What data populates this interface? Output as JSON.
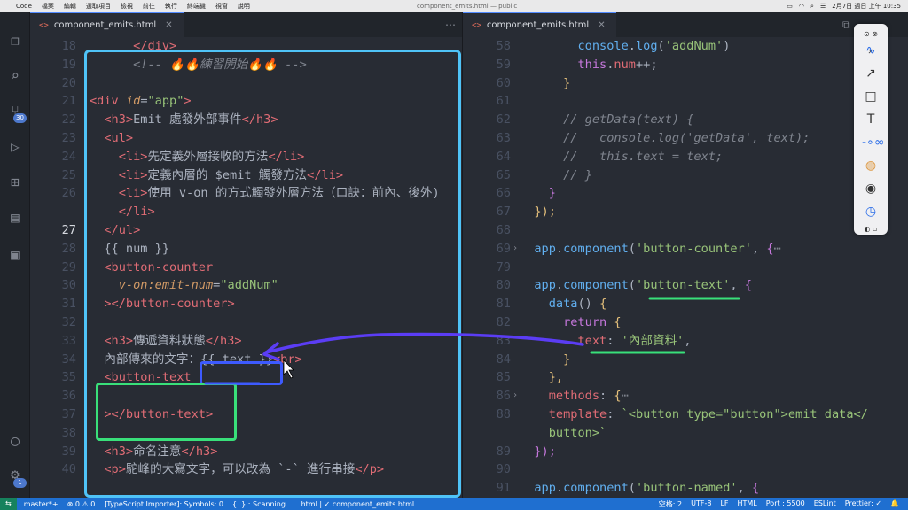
{
  "menubar": {
    "app": "Code",
    "items": [
      "檔案",
      "編輯",
      "選取項目",
      "檢視",
      "前往",
      "執行",
      "終端機",
      "視窗",
      "說明"
    ],
    "window_title": "component_emits.html — public",
    "clock": "2月7日 週日 上午 10:35"
  },
  "activity": {
    "scm_badge": "30",
    "settings_badge": "1"
  },
  "left_editor": {
    "tab_label": "component_emits.html",
    "lines": [
      {
        "n": "18",
        "fold": "",
        "t": [
          [
            "tok-plain",
            "      "
          ],
          [
            "tok-tag",
            "</div>"
          ]
        ]
      },
      {
        "n": "19",
        "fold": "",
        "t": [
          [
            "tok-plain",
            "      "
          ],
          [
            "tok-cmt",
            "<!-- 🔥🔥練習開始🔥🔥 -->"
          ]
        ]
      },
      {
        "n": "20",
        "fold": "",
        "t": []
      },
      {
        "n": "21",
        "fold": "",
        "t": [
          [
            "tok-tag",
            "<div"
          ],
          [
            "tok-plain",
            " "
          ],
          [
            "tok-attr",
            "id"
          ],
          [
            "tok-plain",
            "="
          ],
          [
            "tok-str",
            "\"app\""
          ],
          [
            "tok-tag",
            ">"
          ]
        ]
      },
      {
        "n": "22",
        "fold": "",
        "t": [
          [
            "tok-plain",
            "  "
          ],
          [
            "tok-tag",
            "<h3>"
          ],
          [
            "tok-plain",
            "Emit 處發外部事件"
          ],
          [
            "tok-tag",
            "</h3>"
          ]
        ]
      },
      {
        "n": "23",
        "fold": "",
        "t": [
          [
            "tok-plain",
            "  "
          ],
          [
            "tok-tag",
            "<ul>"
          ]
        ]
      },
      {
        "n": "24",
        "fold": "",
        "t": [
          [
            "tok-plain",
            "    "
          ],
          [
            "tok-tag",
            "<li>"
          ],
          [
            "tok-plain",
            "先定義外層接收的方法"
          ],
          [
            "tok-tag",
            "</li>"
          ]
        ]
      },
      {
        "n": "25",
        "fold": "",
        "t": [
          [
            "tok-plain",
            "    "
          ],
          [
            "tok-tag",
            "<li>"
          ],
          [
            "tok-plain",
            "定義內層的 $emit 觸發方法"
          ],
          [
            "tok-tag",
            "</li>"
          ]
        ]
      },
      {
        "n": "26",
        "fold": "",
        "t": [
          [
            "tok-plain",
            "    "
          ],
          [
            "tok-tag",
            "<li>"
          ],
          [
            "tok-plain",
            "使用 v-on 的方式觸發外層方法（口訣：前內、後外)"
          ]
        ]
      },
      {
        "n": "",
        "fold": "",
        "t": [
          [
            "tok-plain",
            "    "
          ],
          [
            "tok-tag",
            "</li>"
          ]
        ]
      },
      {
        "n": "27",
        "fold": "",
        "active": true,
        "t": [
          [
            "tok-plain",
            "  "
          ],
          [
            "tok-tag",
            "</ul>"
          ]
        ]
      },
      {
        "n": "28",
        "fold": "",
        "t": [
          [
            "tok-plain",
            "  {{ num }}"
          ]
        ]
      },
      {
        "n": "29",
        "fold": "",
        "t": [
          [
            "tok-plain",
            "  "
          ],
          [
            "tok-tag",
            "<button-counter"
          ]
        ]
      },
      {
        "n": "30",
        "fold": "",
        "t": [
          [
            "tok-plain",
            "    "
          ],
          [
            "tok-attr",
            "v-on:emit-num"
          ],
          [
            "tok-plain",
            "="
          ],
          [
            "tok-str",
            "\"addNum\""
          ]
        ]
      },
      {
        "n": "31",
        "fold": "",
        "t": [
          [
            "tok-plain",
            "  "
          ],
          [
            "tok-tag",
            "></button-counter>"
          ]
        ]
      },
      {
        "n": "32",
        "fold": "",
        "t": []
      },
      {
        "n": "33",
        "fold": "",
        "t": [
          [
            "tok-plain",
            "  "
          ],
          [
            "tok-tag",
            "<h3>"
          ],
          [
            "tok-plain",
            "傳遞資料狀態"
          ],
          [
            "tok-tag",
            "</h3>"
          ]
        ]
      },
      {
        "n": "34",
        "fold": "",
        "t": [
          [
            "tok-plain",
            "  內部傳來的文字：{{ text }}"
          ],
          [
            "tok-tag",
            "<br>"
          ]
        ]
      },
      {
        "n": "35",
        "fold": "",
        "t": [
          [
            "tok-plain",
            "  "
          ],
          [
            "tok-tag",
            "<button-text"
          ]
        ]
      },
      {
        "n": "36",
        "fold": "",
        "t": []
      },
      {
        "n": "37",
        "fold": "",
        "t": [
          [
            "tok-plain",
            "  "
          ],
          [
            "tok-tag",
            "></button-text>"
          ]
        ]
      },
      {
        "n": "38",
        "fold": "",
        "t": []
      },
      {
        "n": "39",
        "fold": "",
        "t": [
          [
            "tok-plain",
            "  "
          ],
          [
            "tok-tag",
            "<h3>"
          ],
          [
            "tok-plain",
            "命名注意"
          ],
          [
            "tok-tag",
            "</h3>"
          ]
        ]
      },
      {
        "n": "40",
        "fold": "",
        "t": [
          [
            "tok-plain",
            "  "
          ],
          [
            "tok-tag",
            "<p>"
          ],
          [
            "tok-plain",
            "駝峰的大寫文字，可以改為 `-` 進行串接"
          ],
          [
            "tok-tag",
            "</p>"
          ]
        ]
      }
    ]
  },
  "right_editor": {
    "tab_label": "component_emits.html",
    "lines": [
      {
        "n": "58",
        "fold": "",
        "t": [
          [
            "tok-plain",
            "        "
          ],
          [
            "tok-fn",
            "console"
          ],
          [
            "tok-punc",
            "."
          ],
          [
            "tok-fn",
            "log"
          ],
          [
            "tok-punc",
            "("
          ],
          [
            "tok-str",
            "'addNum'"
          ],
          [
            "tok-punc",
            ")"
          ]
        ]
      },
      {
        "n": "59",
        "fold": "",
        "t": [
          [
            "tok-plain",
            "        "
          ],
          [
            "tok-kw",
            "this"
          ],
          [
            "tok-punc",
            "."
          ],
          [
            "tok-prop",
            "num"
          ],
          [
            "tok-punc",
            "++;"
          ]
        ]
      },
      {
        "n": "60",
        "fold": "",
        "t": [
          [
            "tok-plain",
            "      "
          ],
          [
            "tok-brk",
            "}"
          ]
        ]
      },
      {
        "n": "61",
        "fold": "",
        "t": []
      },
      {
        "n": "62",
        "fold": "",
        "t": [
          [
            "tok-plain",
            "      "
          ],
          [
            "tok-cmt",
            "// getData(text) {"
          ]
        ]
      },
      {
        "n": "63",
        "fold": "",
        "t": [
          [
            "tok-plain",
            "      "
          ],
          [
            "tok-cmt",
            "//   console.log('getData', text);"
          ]
        ]
      },
      {
        "n": "64",
        "fold": "",
        "t": [
          [
            "tok-plain",
            "      "
          ],
          [
            "tok-cmt",
            "//   this.text = text;"
          ]
        ]
      },
      {
        "n": "65",
        "fold": "",
        "t": [
          [
            "tok-plain",
            "      "
          ],
          [
            "tok-cmt",
            "// }"
          ]
        ]
      },
      {
        "n": "66",
        "fold": "",
        "t": [
          [
            "tok-plain",
            "    "
          ],
          [
            "tok-kw",
            "}"
          ]
        ]
      },
      {
        "n": "67",
        "fold": "",
        "t": [
          [
            "tok-plain",
            "  "
          ],
          [
            "tok-brk",
            "});"
          ]
        ]
      },
      {
        "n": "68",
        "fold": "",
        "t": []
      },
      {
        "n": "69",
        "fold": "›",
        "t": [
          [
            "tok-plain",
            "  "
          ],
          [
            "tok-fn",
            "app"
          ],
          [
            "tok-punc",
            "."
          ],
          [
            "tok-fn",
            "component"
          ],
          [
            "tok-punc",
            "("
          ],
          [
            "tok-str",
            "'button-counter'"
          ],
          [
            "tok-punc",
            ", "
          ],
          [
            "tok-kw",
            "{"
          ],
          [
            "tok-cmt",
            "⋯"
          ]
        ]
      },
      {
        "n": "79",
        "fold": "",
        "t": []
      },
      {
        "n": "80",
        "fold": "",
        "t": [
          [
            "tok-plain",
            "  "
          ],
          [
            "tok-fn",
            "app"
          ],
          [
            "tok-punc",
            "."
          ],
          [
            "tok-fn",
            "component"
          ],
          [
            "tok-punc",
            "("
          ],
          [
            "tok-str",
            "'button-text'"
          ],
          [
            "tok-punc",
            ", "
          ],
          [
            "tok-kw",
            "{"
          ]
        ]
      },
      {
        "n": "81",
        "fold": "",
        "t": [
          [
            "tok-plain",
            "    "
          ],
          [
            "tok-fn",
            "data"
          ],
          [
            "tok-punc",
            "() "
          ],
          [
            "tok-brk",
            "{"
          ]
        ]
      },
      {
        "n": "82",
        "fold": "",
        "t": [
          [
            "tok-plain",
            "      "
          ],
          [
            "tok-kw",
            "return"
          ],
          [
            "tok-plain",
            " "
          ],
          [
            "tok-brk",
            "{"
          ]
        ]
      },
      {
        "n": "83",
        "fold": "",
        "t": [
          [
            "tok-plain",
            "        "
          ],
          [
            "tok-prop",
            "text"
          ],
          [
            "tok-punc",
            ": "
          ],
          [
            "tok-str",
            "'內部資料'"
          ],
          [
            "tok-punc",
            ","
          ]
        ]
      },
      {
        "n": "84",
        "fold": "",
        "t": [
          [
            "tok-plain",
            "      "
          ],
          [
            "tok-brk",
            "}"
          ]
        ]
      },
      {
        "n": "85",
        "fold": "",
        "t": [
          [
            "tok-plain",
            "    "
          ],
          [
            "tok-brk",
            "},"
          ]
        ]
      },
      {
        "n": "86",
        "fold": "›",
        "t": [
          [
            "tok-plain",
            "    "
          ],
          [
            "tok-prop",
            "methods"
          ],
          [
            "tok-punc",
            ": "
          ],
          [
            "tok-brk",
            "{"
          ],
          [
            "tok-cmt",
            "⋯"
          ]
        ]
      },
      {
        "n": "88",
        "fold": "",
        "t": [
          [
            "tok-plain",
            "    "
          ],
          [
            "tok-prop",
            "template"
          ],
          [
            "tok-punc",
            ": "
          ],
          [
            "tok-str",
            "`<button type=\"button\">emit data</"
          ]
        ]
      },
      {
        "n": "",
        "fold": "",
        "t": [
          [
            "tok-plain",
            "    "
          ],
          [
            "tok-str",
            "button>`"
          ]
        ]
      },
      {
        "n": "89",
        "fold": "",
        "t": [
          [
            "tok-plain",
            "  "
          ],
          [
            "tok-kw",
            "});"
          ]
        ]
      },
      {
        "n": "90",
        "fold": "",
        "t": []
      },
      {
        "n": "91",
        "fold": "",
        "t": [
          [
            "tok-plain",
            "  "
          ],
          [
            "tok-fn",
            "app"
          ],
          [
            "tok-punc",
            "."
          ],
          [
            "tok-fn",
            "component"
          ],
          [
            "tok-punc",
            "("
          ],
          [
            "tok-str",
            "'button-named'"
          ],
          [
            "tok-punc",
            ", "
          ],
          [
            "tok-kw",
            "{"
          ]
        ]
      }
    ]
  },
  "statusbar": {
    "branch": "master*+",
    "problems": "⊗ 0 ⚠ 0",
    "ts_importer": "[TypeScript Importer]: Symbols: 0",
    "scanning": "{..} : Scanning...",
    "language_crumb": "html | ✓ component_emits.html",
    "spaces": "空格: 2",
    "encoding": "UTF-8",
    "eol": "LF",
    "language": "HTML",
    "port": "Port : 5500",
    "eslint": "ESLint",
    "prettier": "Prettier: ✓"
  },
  "colors": {
    "annotation_cyan": "#4fc3f7",
    "annotation_blue": "#3d5afe",
    "annotation_green": "#39e07a",
    "annotation_arrow": "#5b3df5",
    "status_bar": "#1f6fd0"
  }
}
